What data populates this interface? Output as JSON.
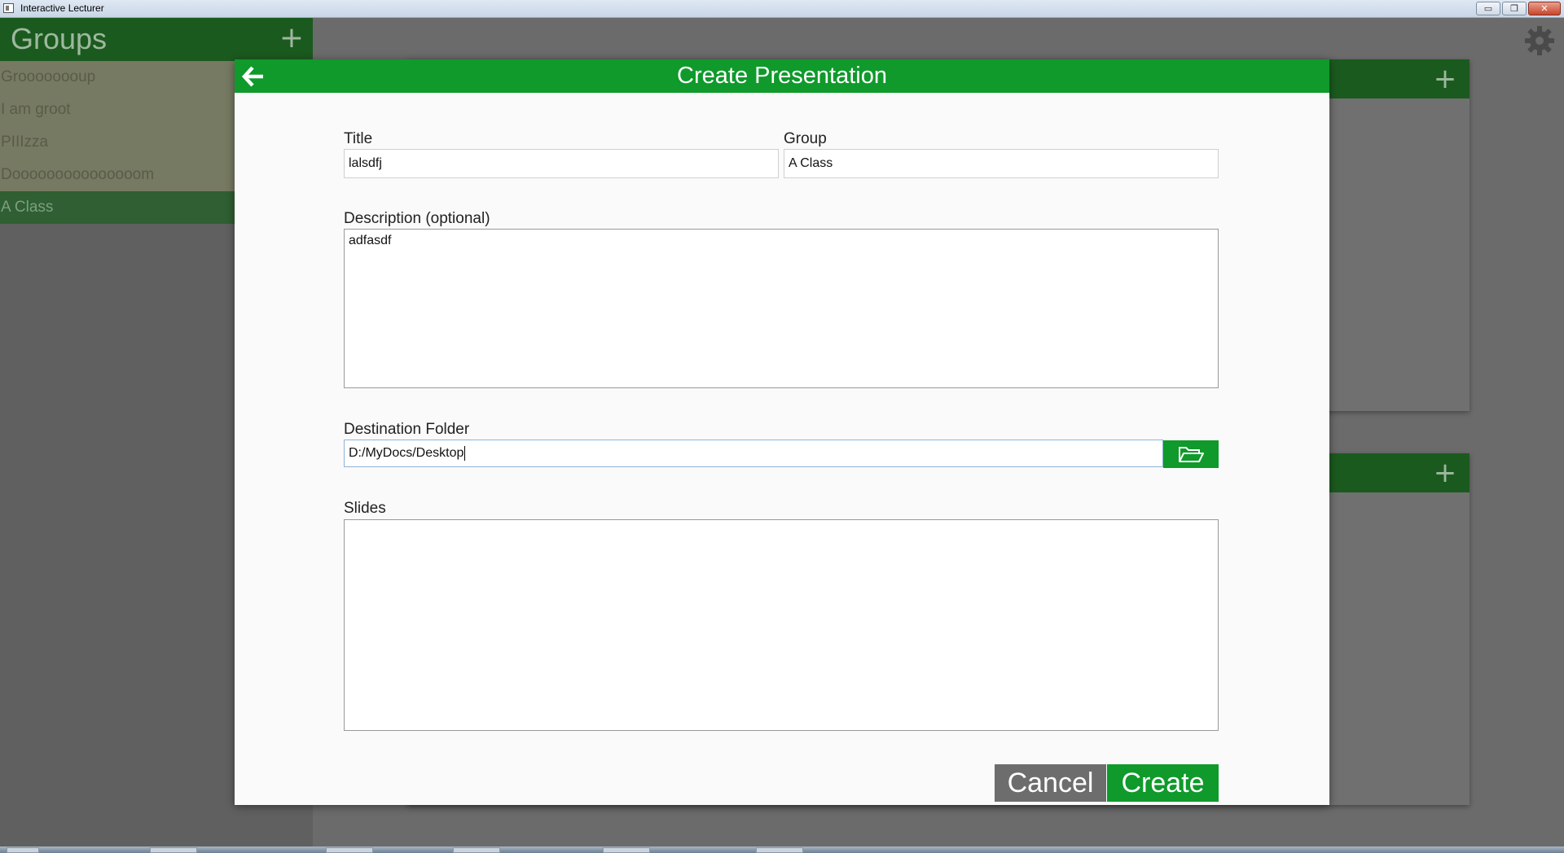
{
  "window": {
    "title": "Interactive Lecturer",
    "buttons": {
      "minimize": "▭",
      "restore": "❐",
      "close": "✕"
    }
  },
  "groups": {
    "title": "Groups",
    "add_label": "+",
    "items": [
      {
        "label": "Groooooooup"
      },
      {
        "label": "I am groot"
      },
      {
        "label": "PIIIzza"
      },
      {
        "label": "Dooooooooooooooom"
      },
      {
        "label": "A Class",
        "active": true
      }
    ]
  },
  "background_cards": {
    "add_label": "+"
  },
  "modal": {
    "title": "Create Presentation",
    "fields": {
      "title": {
        "label": "Title",
        "value": "lalsdfj"
      },
      "group": {
        "label": "Group",
        "value": "A Class"
      },
      "description": {
        "label": "Description (optional)",
        "value": "adfasdf"
      },
      "destination": {
        "label": "Destination Folder",
        "value": "D:/MyDocs/Desktop"
      },
      "slides": {
        "label": "Slides",
        "value": ""
      }
    },
    "buttons": {
      "cancel": "Cancel",
      "create": "Create"
    }
  },
  "colors": {
    "header_green": "#0f9a2b",
    "dark_green": "#1b5a1f",
    "cancel_gray": "#6d6d6d",
    "overlay_gray": "#6b6b6b"
  },
  "icons": {
    "back": "arrow-left-icon",
    "folder": "folder-open-icon",
    "settings": "gear-icon",
    "add": "plus-icon"
  }
}
